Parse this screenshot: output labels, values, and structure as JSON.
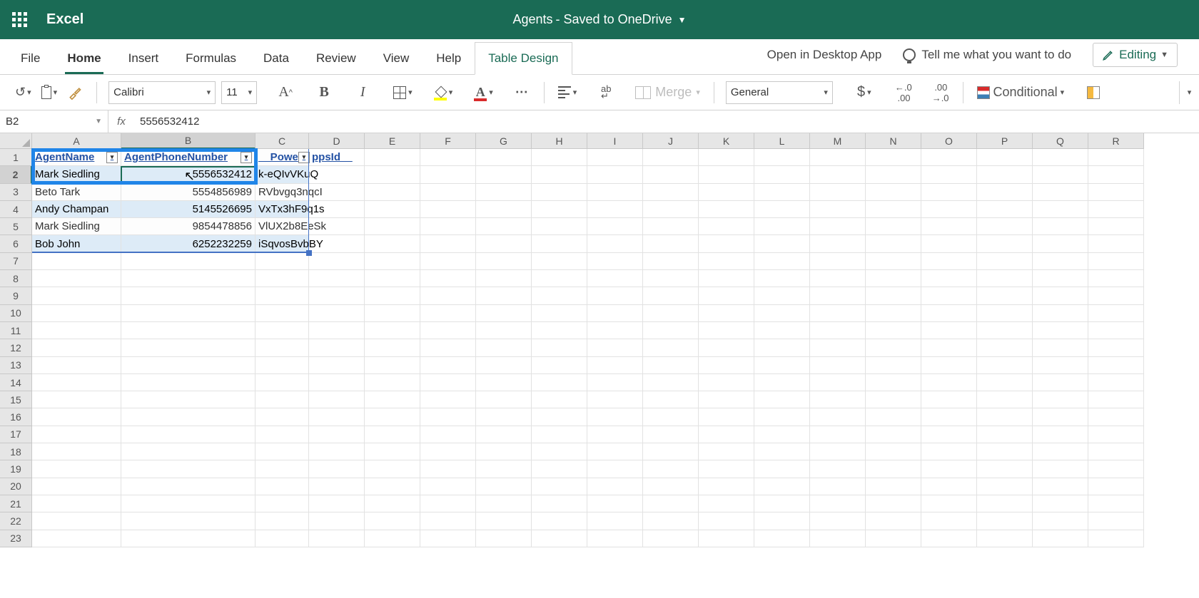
{
  "title_bar": {
    "app_name": "Excel",
    "document_title": "Agents",
    "saved_text": " - Saved to OneDrive"
  },
  "tabs": {
    "file": "File",
    "home": "Home",
    "insert": "Insert",
    "formulas": "Formulas",
    "data": "Data",
    "review": "Review",
    "view": "View",
    "help": "Help",
    "table_design": "Table Design",
    "open_desktop": "Open in Desktop App",
    "tell_me": "Tell me what you want to do",
    "editing": "Editing"
  },
  "toolbar": {
    "font_name": "Calibri",
    "font_size": "11",
    "merge_label": "Merge",
    "number_format": "General",
    "conditional_label": "Conditional",
    "dec_inc_00": ".00",
    "dec_inc_0": ".0",
    "currency": "$",
    "wrap_a": "ab",
    "wrap_arrow": "↵"
  },
  "formula_bar": {
    "name_box": "B2",
    "fx": "fx",
    "formula": "5556532412"
  },
  "grid": {
    "col_widths": {
      "A": 125,
      "B": 188,
      "C": 75,
      "other": 78
    },
    "columns": [
      "A",
      "B",
      "C",
      "D",
      "E",
      "F",
      "G",
      "H",
      "I",
      "J",
      "K",
      "L",
      "M",
      "N",
      "O",
      "P",
      "Q",
      "R"
    ],
    "active_col": "B",
    "active_row": 2,
    "row_count": 23,
    "headers": {
      "A": "AgentName",
      "B": "AgentPhoneNumber",
      "C_display": "Powe",
      "C_overflow": "ppsId__"
    },
    "data_rows": [
      {
        "A": "Mark Siedling",
        "B": "5556532412",
        "C": "k-eQIvVKuQ"
      },
      {
        "A": "Beto Tark",
        "B": "5554856989",
        "C": "RVbvgq3nqcI"
      },
      {
        "A": "Andy Champan",
        "B": "5145526695",
        "C": "VxTx3hF9q1s"
      },
      {
        "A": "Mark Siedling",
        "B": "9854478856",
        "C": "VlUX2b8EeSk"
      },
      {
        "A": "Bob John",
        "B": "6252232259",
        "C": "iSqvosBvbBY"
      }
    ]
  }
}
